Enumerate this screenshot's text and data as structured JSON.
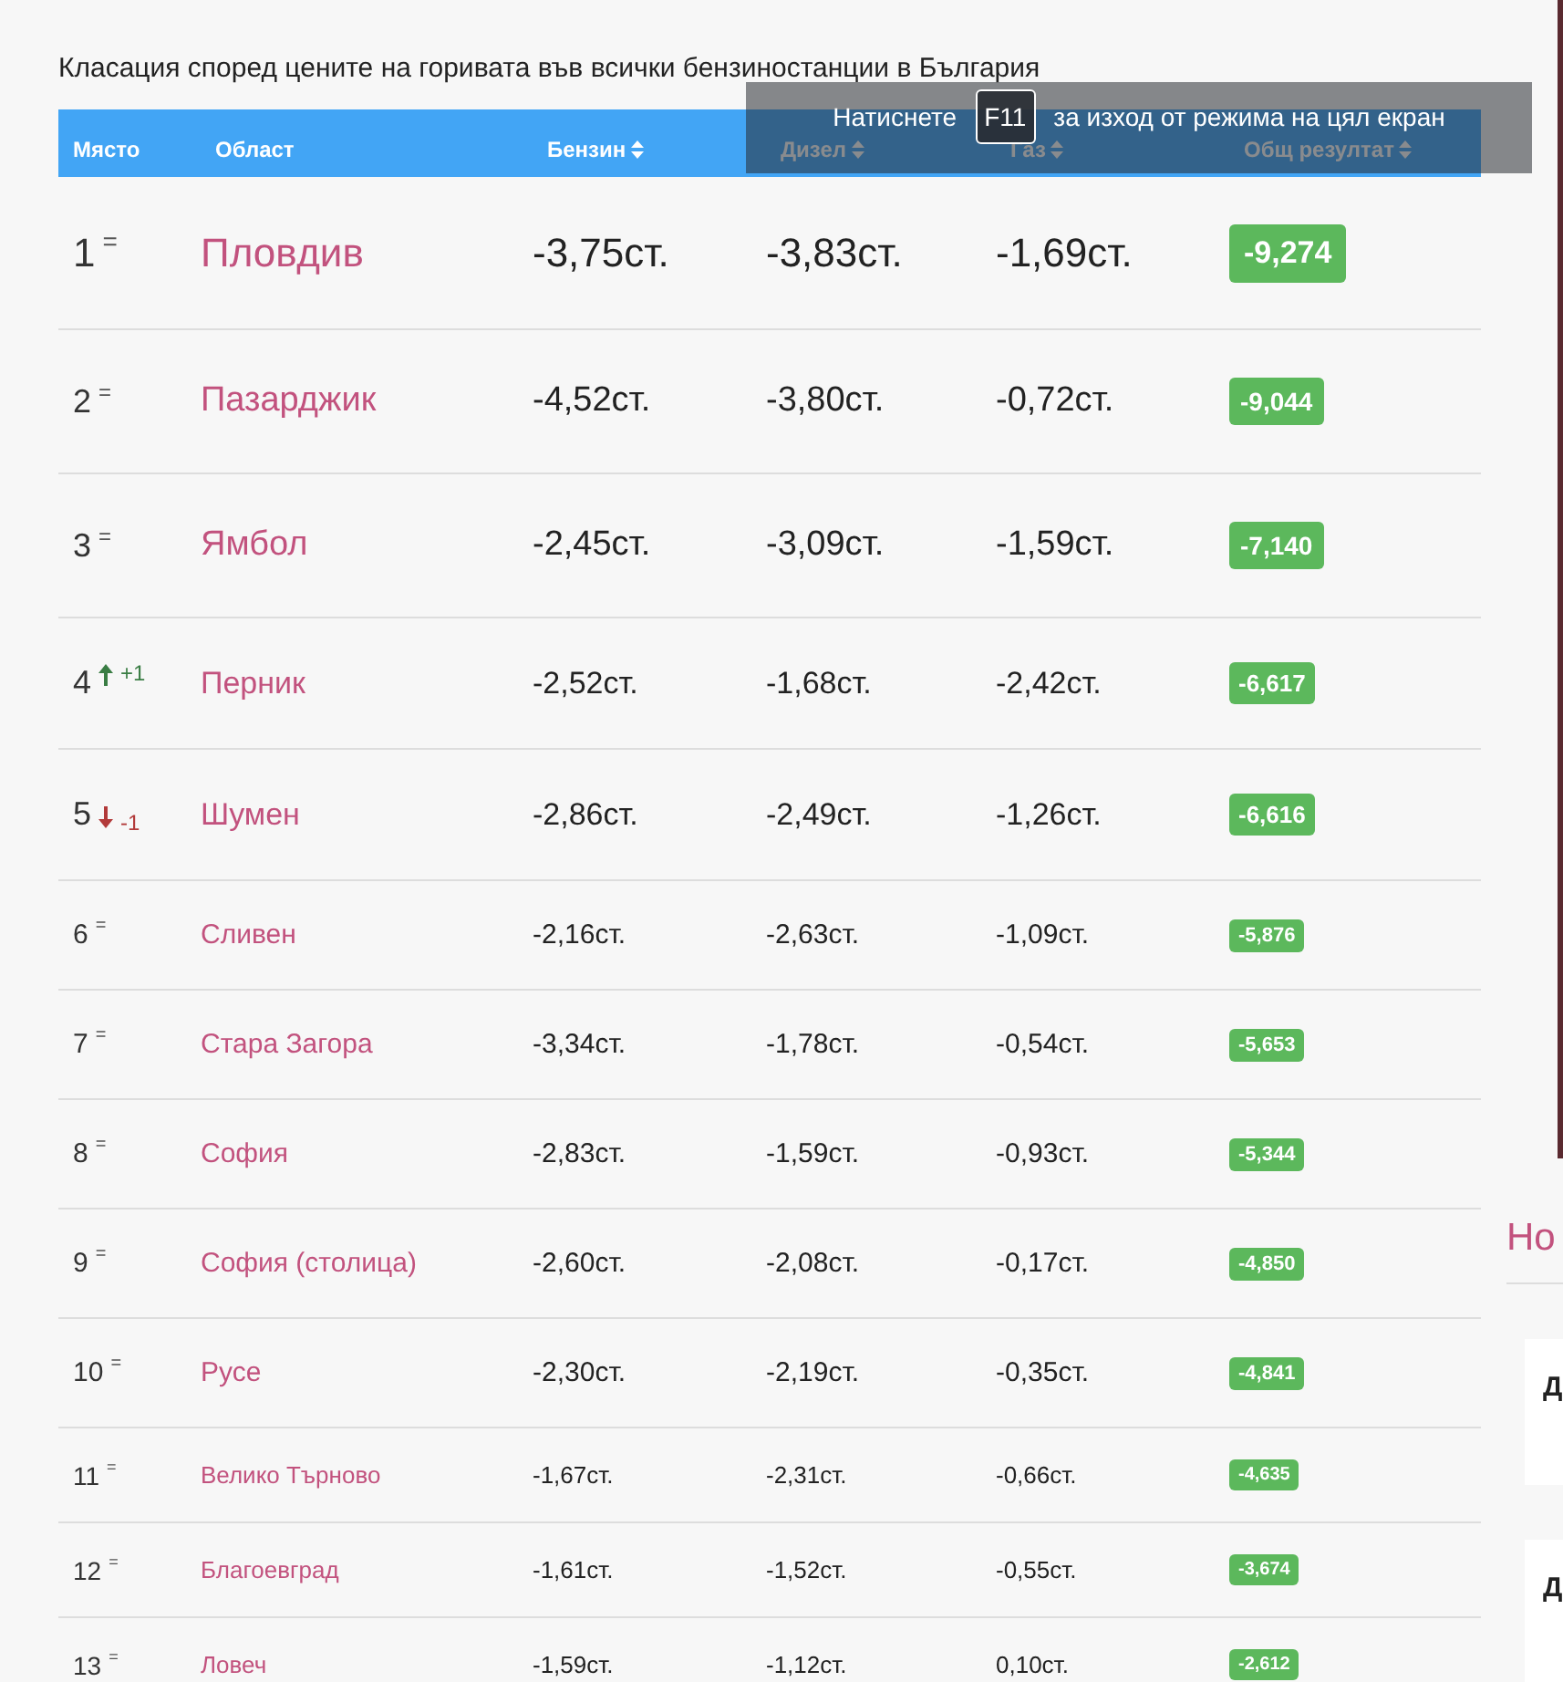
{
  "title": "Класация според цените на горивата във всички бензиностанции в България",
  "columns": [
    {
      "label": "Място",
      "sortable": false
    },
    {
      "label": "Област",
      "sortable": false
    },
    {
      "label": "Бензин",
      "sortable": true
    },
    {
      "label": "Дизел",
      "sortable": true
    },
    {
      "label": "Газ",
      "sortable": true
    },
    {
      "label": "Общ резултат",
      "sortable": true
    }
  ],
  "rows": [
    {
      "place": "1",
      "change": {
        "kind": "same",
        "text": "="
      },
      "region": "Пловдив",
      "petrol": "-3,75ст.",
      "diesel": "-3,83ст.",
      "gas": "-1,69ст.",
      "score": "-9,274"
    },
    {
      "place": "2",
      "change": {
        "kind": "same",
        "text": "="
      },
      "region": "Пазарджик",
      "petrol": "-4,52ст.",
      "diesel": "-3,80ст.",
      "gas": "-0,72ст.",
      "score": "-9,044"
    },
    {
      "place": "3",
      "change": {
        "kind": "same",
        "text": "="
      },
      "region": "Ямбол",
      "petrol": "-2,45ст.",
      "diesel": "-3,09ст.",
      "gas": "-1,59ст.",
      "score": "-7,140"
    },
    {
      "place": "4",
      "change": {
        "kind": "up",
        "text": "+1"
      },
      "region": "Перник",
      "petrol": "-2,52ст.",
      "diesel": "-1,68ст.",
      "gas": "-2,42ст.",
      "score": "-6,617"
    },
    {
      "place": "5",
      "change": {
        "kind": "down",
        "text": "-1"
      },
      "region": "Шумен",
      "petrol": "-2,86ст.",
      "diesel": "-2,49ст.",
      "gas": "-1,26ст.",
      "score": "-6,616"
    },
    {
      "place": "6",
      "change": {
        "kind": "same",
        "text": "="
      },
      "region": "Сливен",
      "petrol": "-2,16ст.",
      "diesel": "-2,63ст.",
      "gas": "-1,09ст.",
      "score": "-5,876"
    },
    {
      "place": "7",
      "change": {
        "kind": "same",
        "text": "="
      },
      "region": "Стара Загора",
      "petrol": "-3,34ст.",
      "diesel": "-1,78ст.",
      "gas": "-0,54ст.",
      "score": "-5,653"
    },
    {
      "place": "8",
      "change": {
        "kind": "same",
        "text": "="
      },
      "region": "София",
      "petrol": "-2,83ст.",
      "diesel": "-1,59ст.",
      "gas": "-0,93ст.",
      "score": "-5,344"
    },
    {
      "place": "9",
      "change": {
        "kind": "same",
        "text": "="
      },
      "region": "София (столица)",
      "petrol": "-2,60ст.",
      "diesel": "-2,08ст.",
      "gas": "-0,17ст.",
      "score": "-4,850"
    },
    {
      "place": "10",
      "change": {
        "kind": "same",
        "text": "="
      },
      "region": "Русе",
      "petrol": "-2,30ст.",
      "diesel": "-2,19ст.",
      "gas": "-0,35ст.",
      "score": "-4,841"
    },
    {
      "place": "11",
      "change": {
        "kind": "same",
        "text": "="
      },
      "region": "Велико Търново",
      "petrol": "-1,67ст.",
      "diesel": "-2,31ст.",
      "gas": "-0,66ст.",
      "score": "-4,635"
    },
    {
      "place": "12",
      "change": {
        "kind": "same",
        "text": "="
      },
      "region": "Благоевград",
      "petrol": "-1,61ст.",
      "diesel": "-1,52ст.",
      "gas": "-0,55ст.",
      "score": "-3,674"
    },
    {
      "place": "13",
      "change": {
        "kind": "same",
        "text": "="
      },
      "region": "Ловеч",
      "petrol": "-1,59ст.",
      "diesel": "-1,12ст.",
      "gas": "0,10ст.",
      "score": "-2,612"
    }
  ],
  "sidebar": {
    "heading": "Но",
    "cards": [
      {
        "letter": "Д"
      },
      {
        "letter": "Д"
      }
    ]
  },
  "fullscreen_notice": {
    "before": "Натиснете",
    "key": "F11",
    "after": "за изход от режима на цял екран"
  }
}
